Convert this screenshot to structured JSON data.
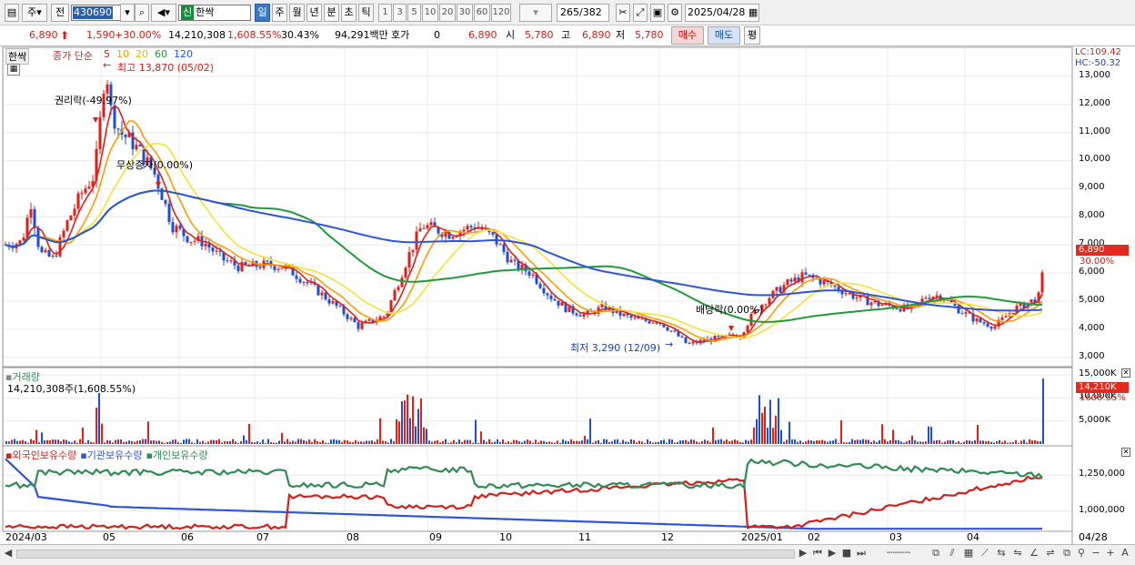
{
  "toolbar": {
    "period_type": "주",
    "prev_label": "전",
    "stock_code": "430690",
    "credit_badge": "신",
    "stock_name": "한싹",
    "period_buttons": [
      "일",
      "주",
      "월",
      "년",
      "분",
      "초",
      "틱"
    ],
    "interval_buttons": [
      "1",
      "3",
      "5",
      "10",
      "20",
      "30",
      "60",
      "120"
    ],
    "active_period": "일",
    "count_display": "265",
    "count_total": "/382",
    "date": "2025/04/28"
  },
  "quote": {
    "price": "6,890",
    "change": "1,590",
    "change_pct": "+30.00%",
    "volume": "14,210,308",
    "volume_pct": "1,608.55%",
    "turnover_pct": "30.43%",
    "amount": "94,291백만",
    "hoga_label": "호가",
    "hoga_value": "0",
    "price2": "6,890",
    "open_label": "시",
    "open": "5,780",
    "high_label": "고",
    "high": "6,890",
    "low_label": "저",
    "low": "5,780",
    "buy_label": "매수",
    "sell_label": "매도",
    "eval_label": "평"
  },
  "price_panel": {
    "title": "한싹",
    "legend_label": "종가 단순",
    "ma_periods": [
      "5",
      "10",
      "20",
      "60",
      "120"
    ],
    "ma_colors": [
      "#e0201a",
      "#ff9c00",
      "#f5e33a",
      "#1f9b3a",
      "#2e55d8"
    ],
    "lc": "LC:109.42",
    "hc": "HC:-50.32",
    "y_ticks": [
      "13,000",
      "12,000",
      "11,000",
      "10,000",
      "9,000",
      "8,000",
      "7,000",
      "6,000",
      "5,000",
      "4,000",
      "3,000"
    ],
    "current_tag": "6,890",
    "current_pct": "30.00%",
    "annot_high": "최고 13,870 (05/02)",
    "annot_rights": "권리락(-49.97%)",
    "annot_bonus": "무상증자(0.00%)",
    "annot_dividend": "배당락(0.00%)",
    "annot_low": "최저 3,290 (12/09)"
  },
  "volume_panel": {
    "title": "거래량",
    "summary": "14,210,308주(1,608.55%)",
    "y_ticks": [
      "15,000K",
      "10,000K",
      "5,000K"
    ],
    "current_tag": "14,210K",
    "current_pct": "1608.55%"
  },
  "holding_panel": {
    "legend": [
      "외국인보유수량",
      "기관보유수량",
      "개인보유수량"
    ],
    "legend_colors": [
      "#d4201a",
      "#2e55d8",
      "#2e8b57"
    ],
    "y_ticks": [
      "1,250,000",
      "1,000,000"
    ]
  },
  "x_axis": {
    "labels": [
      "2024/03",
      "05",
      "06",
      "07",
      "08",
      "09",
      "10",
      "11",
      "12",
      "2025/01",
      "02",
      "03",
      "04"
    ],
    "last_label": "04/28"
  }
}
